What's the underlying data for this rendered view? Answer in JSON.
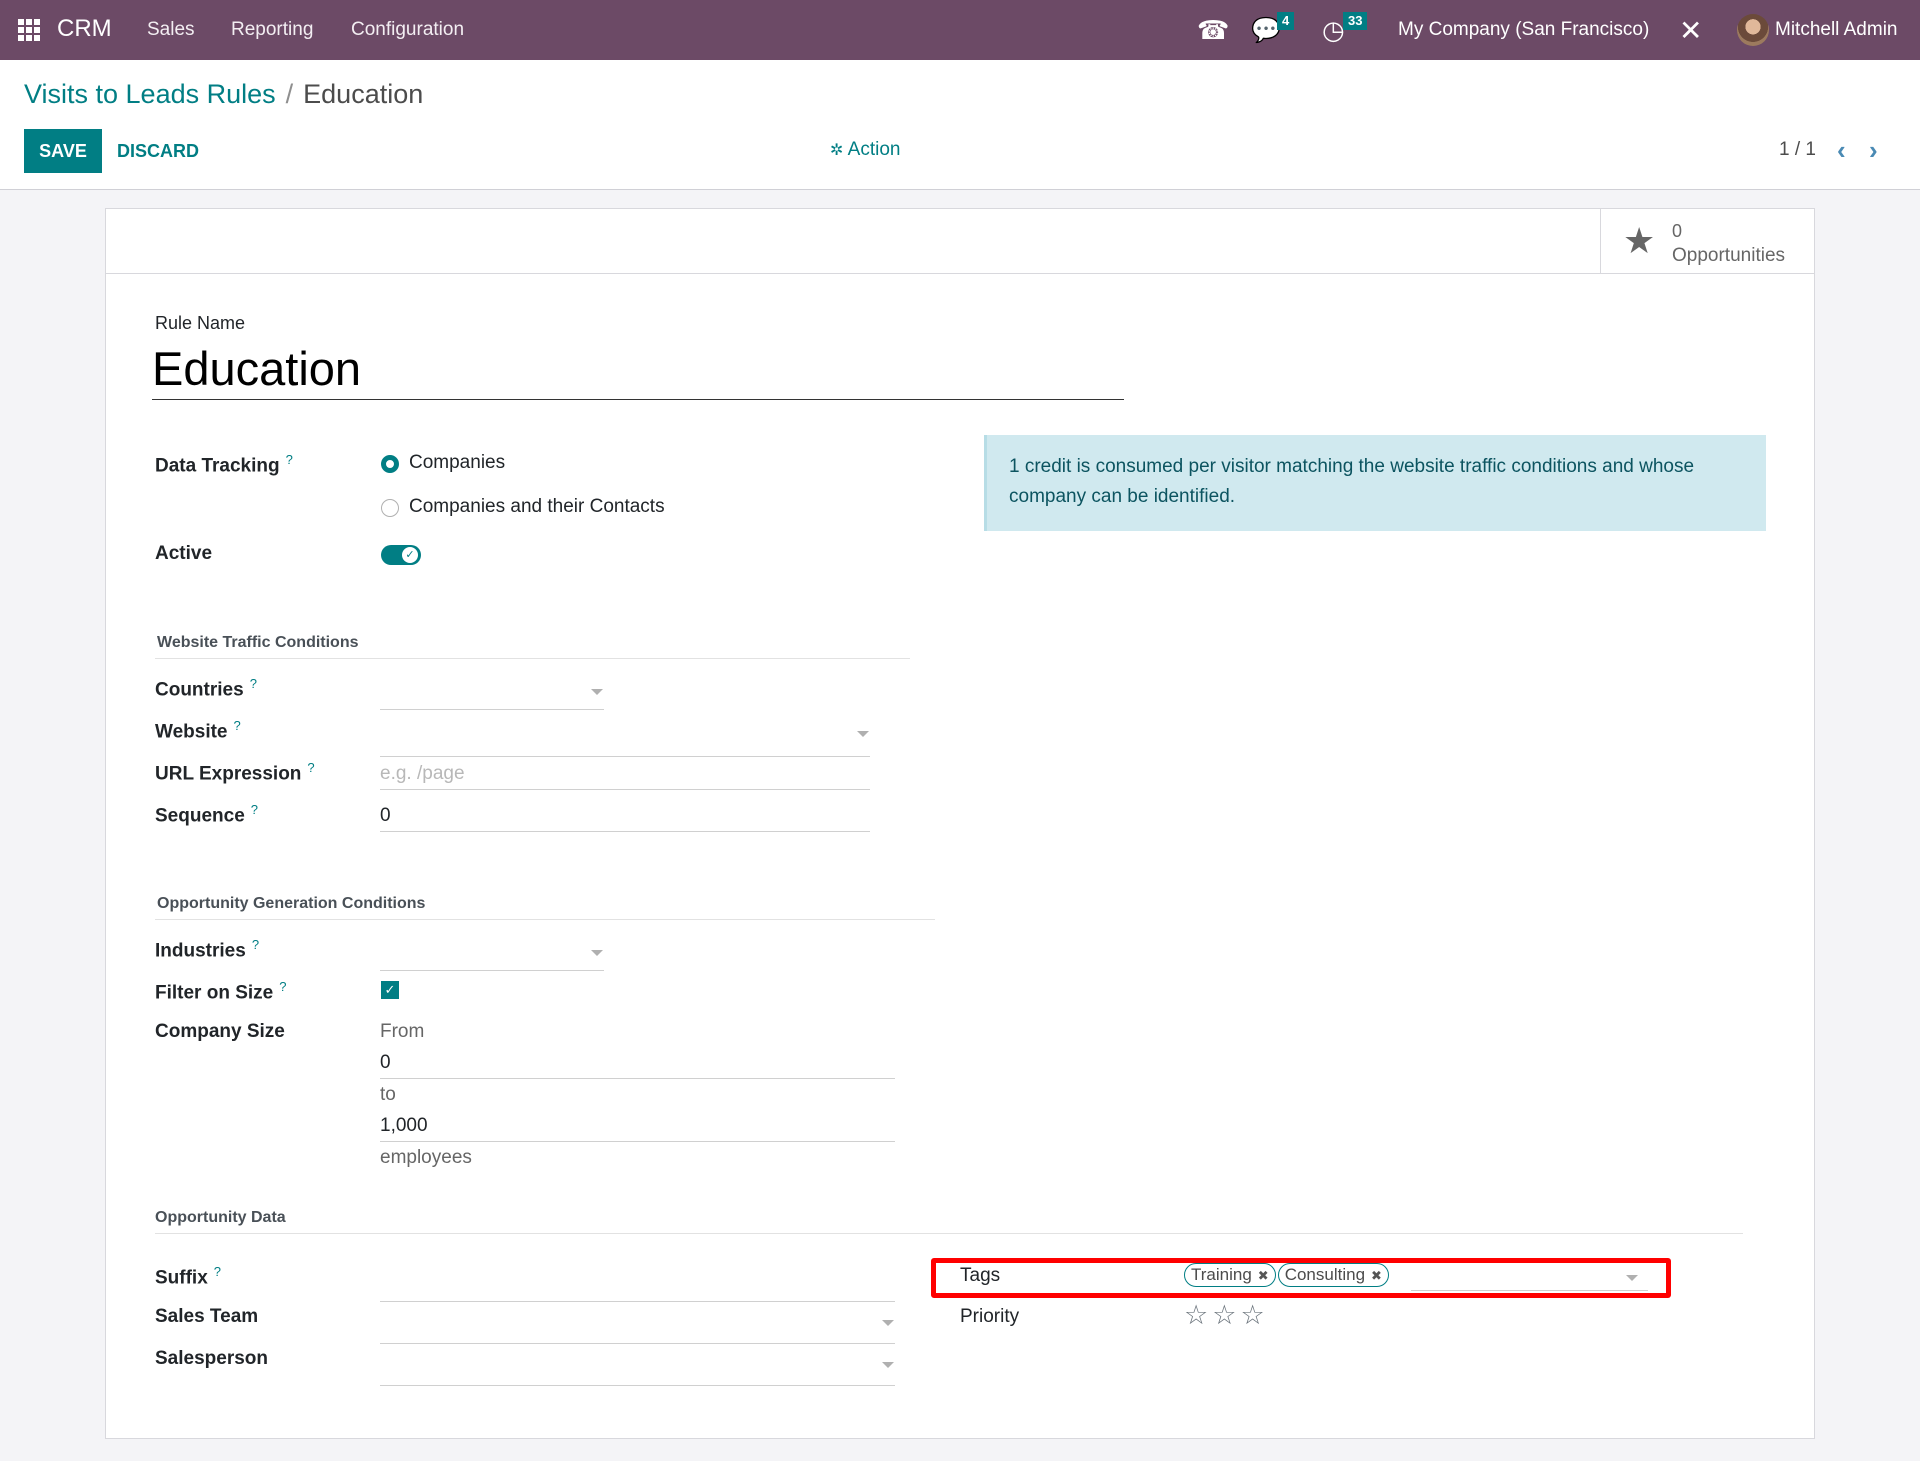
{
  "navbar": {
    "app_name": "CRM",
    "menus": [
      "Sales",
      "Reporting",
      "Configuration"
    ],
    "icons": [
      "apps-icon",
      "phone-icon",
      "chat-icon",
      "activity-clock-icon",
      "debug-tools-icon"
    ],
    "messages_count": "4",
    "activities_count": "33",
    "company": "My Company (San Francisco)",
    "user": "Mitchell Admin",
    "brand_color": "#6c4a66",
    "accent_color": "#017e84"
  },
  "breadcrumb": {
    "parent": "Visits to Leads Rules",
    "separator": "/",
    "current": "Education"
  },
  "toolbar": {
    "save_label": "SAVE",
    "discard_label": "DISCARD",
    "action_label": "Action",
    "pager": "1 / 1",
    "prev_icon": "‹",
    "next_icon": "›"
  },
  "stat_button": {
    "value": "0",
    "label": "Opportunities"
  },
  "form": {
    "rule_name_label": "Rule Name",
    "rule_name": "Education",
    "data_tracking": {
      "label": "Data Tracking",
      "help": "?",
      "options": [
        "Companies",
        "Companies and their Contacts"
      ],
      "selected": "Companies"
    },
    "active": {
      "label": "Active",
      "value": true
    },
    "info_alert": "1 credit is consumed per visitor matching the website traffic conditions and whose company can be identified.",
    "website_traffic": {
      "title": "Website Traffic Conditions",
      "countries": {
        "label": "Countries",
        "help": "?",
        "value": ""
      },
      "website": {
        "label": "Website",
        "help": "?",
        "value": ""
      },
      "url_expression": {
        "label": "URL Expression",
        "help": "?",
        "placeholder": "e.g. /page",
        "value": ""
      },
      "sequence": {
        "label": "Sequence",
        "help": "?",
        "value": "0"
      }
    },
    "opportunity_generation": {
      "title": "Opportunity Generation Conditions",
      "industries": {
        "label": "Industries",
        "help": "?",
        "value": ""
      },
      "filter_on_size": {
        "label": "Filter on Size",
        "help": "?",
        "value": true
      },
      "company_size": {
        "label": "Company Size",
        "from_label": "From",
        "from_value": "0",
        "to_label": "to",
        "to_value": "1,000",
        "unit_label": "employees"
      }
    },
    "opportunity_data": {
      "title": "Opportunity Data",
      "suffix": {
        "label": "Suffix",
        "help": "?",
        "value": ""
      },
      "sales_team": {
        "label": "Sales Team",
        "value": ""
      },
      "salesperson": {
        "label": "Salesperson",
        "value": ""
      },
      "tags": {
        "label": "Tags",
        "values": [
          "Training",
          "Consulting"
        ],
        "remove_icon": "✖"
      },
      "priority": {
        "label": "Priority",
        "stars": 3,
        "value": 0,
        "star_icon": "☆"
      }
    }
  },
  "highlight_color": "#ff0000"
}
